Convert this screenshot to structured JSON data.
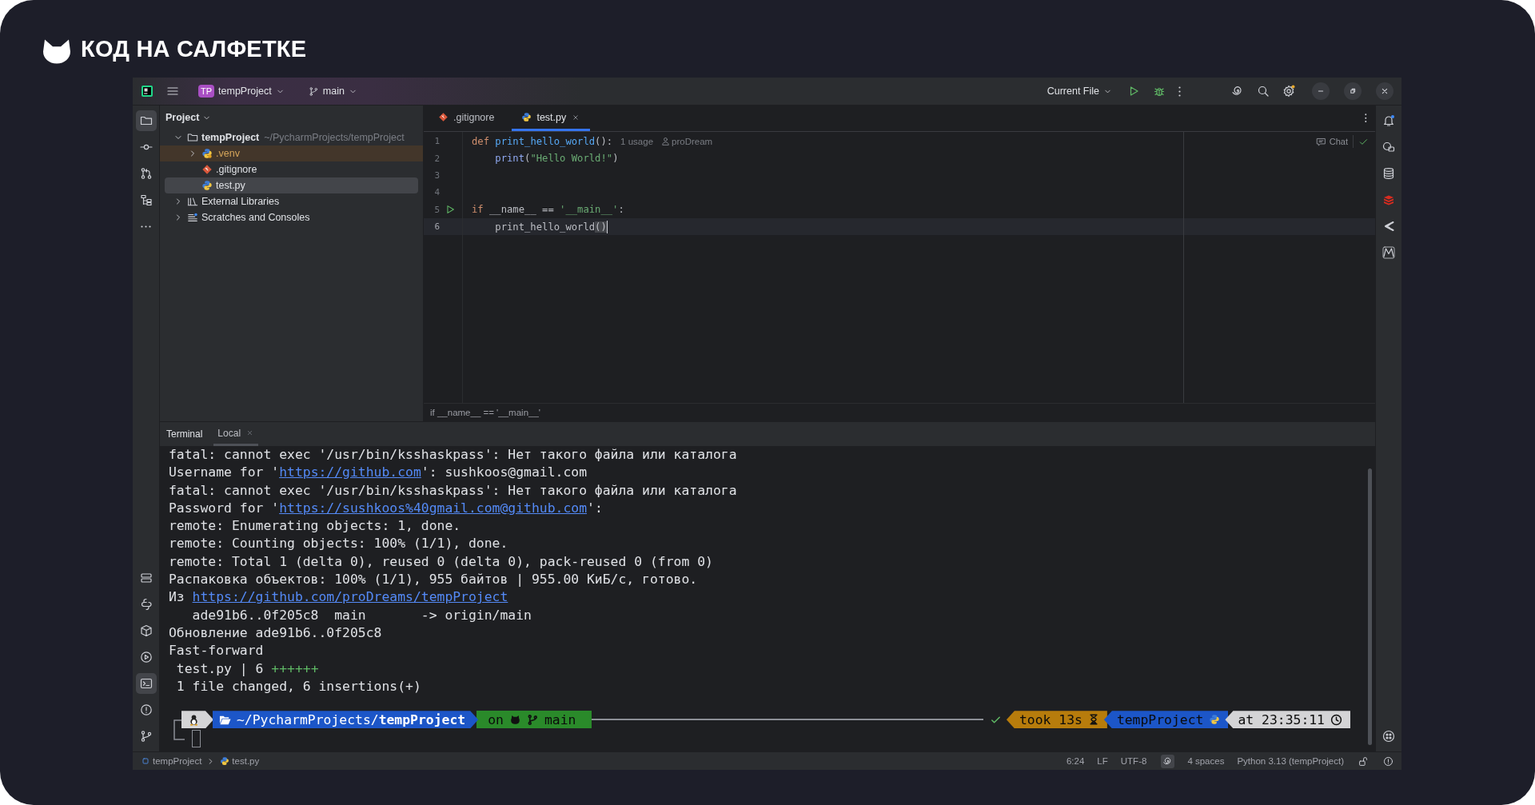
{
  "brand": {
    "name": "КОД НА САЛФЕТКЕ"
  },
  "titlebar": {
    "project_badge": "TP",
    "project": "tempProject",
    "branch": "main",
    "run_config": "Current File"
  },
  "left_toolbar": {
    "top": [
      {
        "kind": "project",
        "selected": true
      },
      {
        "kind": "commit",
        "selected": false
      },
      {
        "kind": "pull_requests",
        "selected": false
      },
      {
        "kind": "structure",
        "selected": false
      },
      {
        "kind": "more",
        "selected": false
      }
    ],
    "bottom": [
      {
        "kind": "services",
        "selected": false
      },
      {
        "kind": "python_console",
        "selected": false
      },
      {
        "kind": "packages",
        "selected": false
      },
      {
        "kind": "run",
        "selected": false
      },
      {
        "kind": "terminal",
        "selected": true
      },
      {
        "kind": "problems",
        "selected": false
      },
      {
        "kind": "git",
        "selected": false
      }
    ]
  },
  "project_panel": {
    "title": "Project",
    "tree": [
      {
        "label": "tempProject",
        "path": "~/PycharmProjects/tempProject",
        "kind": "folder",
        "expanded": true,
        "selected": false,
        "excluded": false,
        "children": [
          {
            "label": ".venv",
            "kind": "venv",
            "expanded": false,
            "selected": false,
            "excluded": true
          },
          {
            "label": ".gitignore",
            "kind": "git",
            "selected": false,
            "excluded": false
          },
          {
            "label": "test.py",
            "kind": "python",
            "selected": true,
            "excluded": false
          }
        ]
      },
      {
        "label": "External Libraries",
        "kind": "library",
        "expanded": false,
        "selected": false,
        "excluded": false
      },
      {
        "label": "Scratches and Consoles",
        "kind": "scratches",
        "expanded": false,
        "selected": false,
        "excluded": false
      }
    ]
  },
  "editor": {
    "tabs": [
      {
        "label": ".gitignore",
        "kind": "git",
        "selected": false
      },
      {
        "label": "test.py",
        "kind": "python",
        "selected": true
      }
    ],
    "chat": "Chat",
    "lines": [
      {
        "number": "1",
        "run": false,
        "current": false,
        "tokens": [
          {
            "kind": "kw",
            "text": "def"
          },
          {
            "kind": "fn",
            "text": " print_hello_world"
          },
          {
            "kind": "plain",
            "text": "():"
          }
        ],
        "hints": {
          "usages": "1 usage",
          "author": "proDream"
        }
      },
      {
        "number": "2",
        "run": false,
        "current": false,
        "tokens": [
          {
            "kind": "builtin",
            "text": "    print"
          },
          {
            "kind": "plain",
            "text": "("
          },
          {
            "kind": "str",
            "text": "\"Hello World!\""
          },
          {
            "kind": "plain",
            "text": ")"
          }
        ]
      },
      {
        "number": "3",
        "run": false,
        "current": false
      },
      {
        "number": "4",
        "run": false,
        "current": false
      },
      {
        "number": "5",
        "run": true,
        "current": false,
        "tokens": [
          {
            "kind": "kw",
            "text": "if"
          },
          {
            "kind": "plain",
            "text": " __name__ == "
          },
          {
            "kind": "str",
            "text": "'__main__'"
          },
          {
            "kind": "plain",
            "text": ":"
          }
        ]
      },
      {
        "number": "6",
        "run": false,
        "current": true,
        "tokens": [
          {
            "kind": "plain",
            "text": "    print_hello_world"
          },
          {
            "kind": "match",
            "text": "()"
          }
        ]
      }
    ],
    "breadcrumb": "if __name__ == '__main__'"
  },
  "terminal": {
    "title": "Terminal",
    "tabs": [
      {
        "label": "Local",
        "selected": true
      }
    ],
    "lines": [
      [
        {
          "kind": "text",
          "text": "fatal: cannot exec '/usr/bin/ksshaskpass': Нет такого файла или каталога"
        }
      ],
      [
        {
          "kind": "text",
          "text": "Username for '"
        },
        {
          "kind": "link",
          "text": "https://github.com"
        },
        {
          "kind": "text",
          "text": "': sushkoos@gmail.com"
        }
      ],
      [
        {
          "kind": "text",
          "text": "fatal: cannot exec '/usr/bin/ksshaskpass': Нет такого файла или каталога"
        }
      ],
      [
        {
          "kind": "text",
          "text": "Password for '"
        },
        {
          "kind": "link",
          "text": "https://sushkoos%40gmail.com@github.com"
        },
        {
          "kind": "text",
          "text": "':"
        }
      ],
      [
        {
          "kind": "text",
          "text": "remote: Enumerating objects: 1, done."
        }
      ],
      [
        {
          "kind": "text",
          "text": "remote: Counting objects: 100% (1/1), done."
        }
      ],
      [
        {
          "kind": "text",
          "text": "remote: Total 1 (delta 0), reused 0 (delta 0), pack-reused 0 (from 0)"
        }
      ],
      [
        {
          "kind": "text",
          "text": "Распаковка объектов: 100% (1/1), 955 байтов | 955.00 КиБ/с, готово."
        }
      ],
      [
        {
          "kind": "text",
          "text": "Из "
        },
        {
          "kind": "link",
          "text": "https://github.com/proDreams/tempProject"
        }
      ],
      [
        {
          "kind": "text",
          "text": "   ade91b6..0f205c8  main       -> origin/main"
        }
      ],
      [
        {
          "kind": "text",
          "text": "Обновление ade91b6..0f205c8"
        }
      ],
      [
        {
          "kind": "text",
          "text": "Fast-forward"
        }
      ],
      [
        {
          "kind": "text",
          "text": " test.py | 6 "
        },
        {
          "kind": "plus",
          "text": "++++++"
        }
      ],
      [
        {
          "kind": "text",
          "text": " 1 file changed, 6 insertions(+)"
        }
      ]
    ],
    "prompt": {
      "path": "~/PycharmProjects/**tempProject**",
      "git_prefix": "on",
      "branch": "main",
      "duration": "took 13s",
      "env": "tempProject",
      "time": "at 23:35:11"
    }
  },
  "status_bar": {
    "breadcrumb": [
      {
        "label": "tempProject",
        "kind": "module"
      },
      {
        "label": "test.py",
        "kind": "python"
      }
    ],
    "position": "6:24",
    "line_separator": "LF",
    "encoding": "UTF-8",
    "indent": "4 spaces",
    "interpreter": "Python 3.13 (tempProject)"
  }
}
